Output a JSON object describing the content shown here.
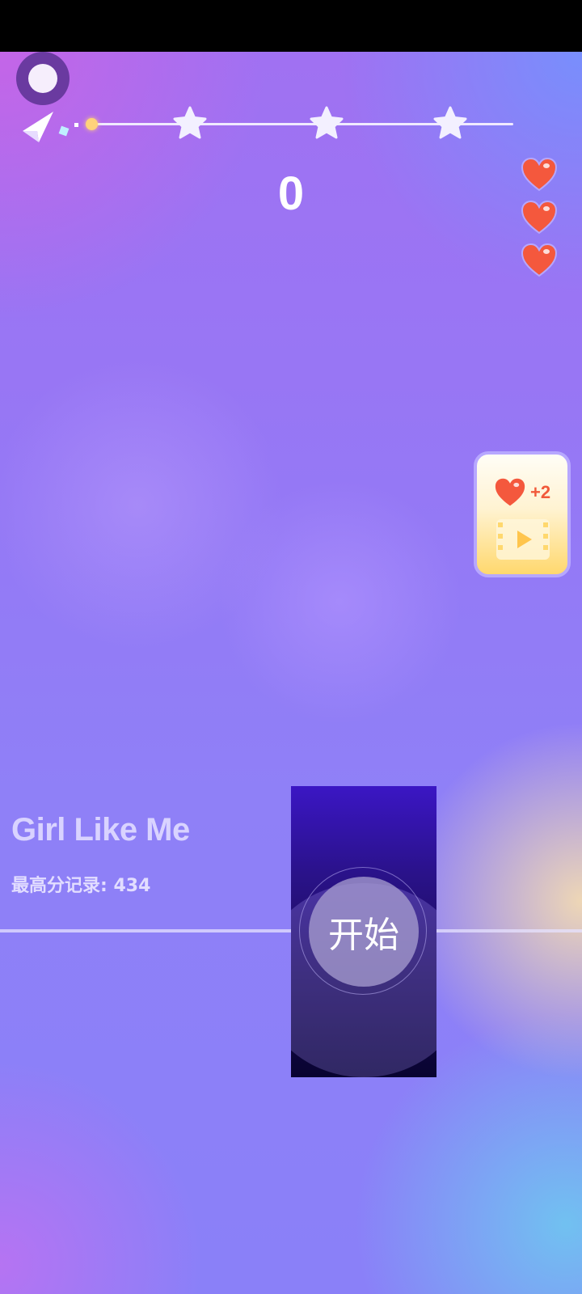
{
  "hud": {
    "score": "0",
    "lives": 3,
    "progress_stars": 3,
    "progress_fraction": 0.0
  },
  "reward": {
    "label": "+2",
    "icons": [
      "heart-icon",
      "video-icon"
    ]
  },
  "song": {
    "title": "Girl Like Me",
    "best_score": "最高分记录: 434"
  },
  "start_tile": {
    "label": "开始"
  },
  "colors": {
    "heart": "#f4583d",
    "star": "#f3f0ff",
    "progress_dot": "#ffd27a",
    "tile_top": "#3b16c4",
    "tile_bottom": "#080330"
  },
  "icons": {
    "pause": "pause-icon",
    "plane": "paper-plane-icon",
    "star": "star-icon",
    "heart": "heart-icon"
  }
}
